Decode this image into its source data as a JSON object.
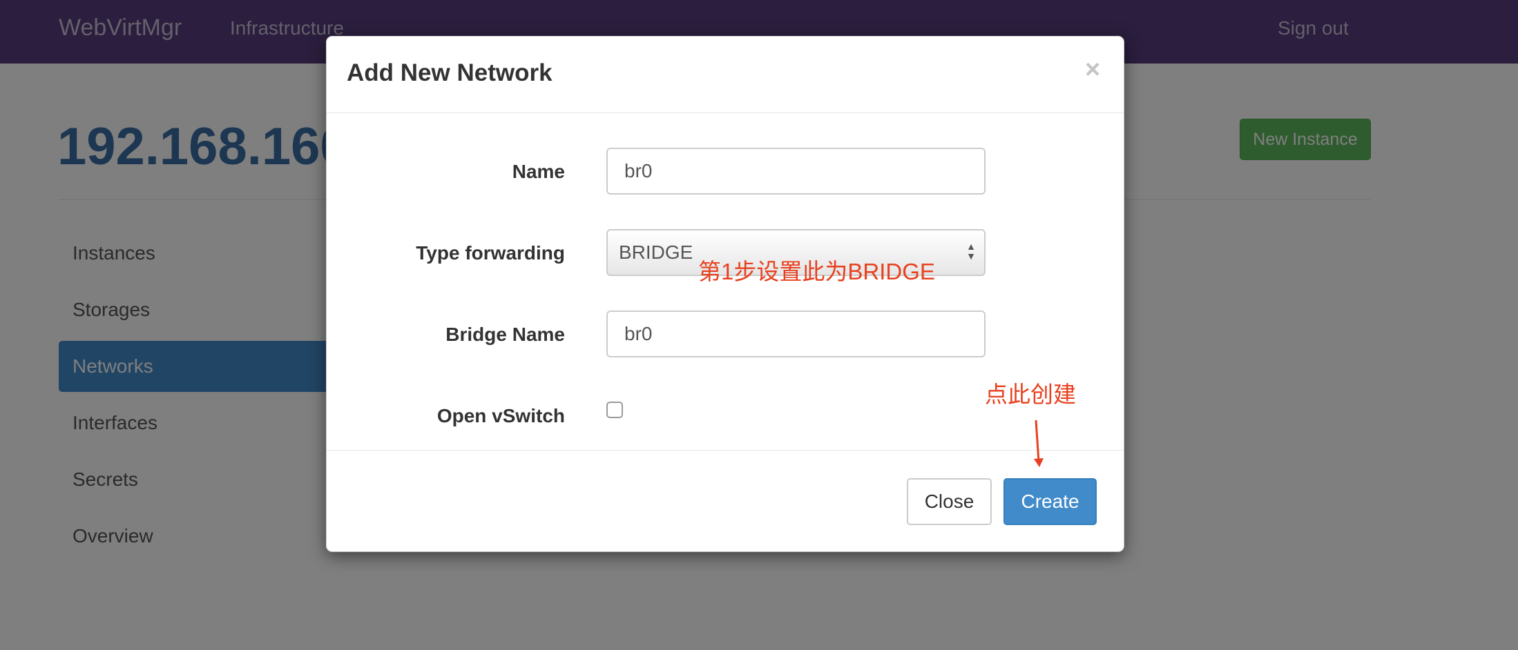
{
  "navbar": {
    "brand": "WebVirtMgr",
    "infrastructure": "Infrastructure",
    "sign_out": "Sign out"
  },
  "header": {
    "host_title": "192.168.160",
    "new_instance": "New Instance"
  },
  "sidebar": {
    "items": [
      {
        "label": "Instances",
        "active": false
      },
      {
        "label": "Storages",
        "active": false
      },
      {
        "label": "Networks",
        "active": true
      },
      {
        "label": "Interfaces",
        "active": false
      },
      {
        "label": "Secrets",
        "active": false
      },
      {
        "label": "Overview",
        "active": false
      }
    ]
  },
  "modal": {
    "title": "Add New Network",
    "close_symbol": "×",
    "fields": {
      "name_label": "Name",
      "name_value": "br0",
      "type_label": "Type forwarding",
      "type_value": "BRIDGE",
      "bridge_label": "Bridge Name",
      "bridge_value": "br0",
      "ovs_label": "Open vSwitch",
      "ovs_checked": false
    },
    "close_button": "Close",
    "create_button": "Create"
  },
  "annotations": {
    "step1": "第1步设置此为BRIDGE",
    "create_here": "点此创建"
  },
  "colors": {
    "navbar": "#563d7c",
    "primary": "#428bca",
    "success": "#5cb85c",
    "annotation": "#e8401f"
  }
}
